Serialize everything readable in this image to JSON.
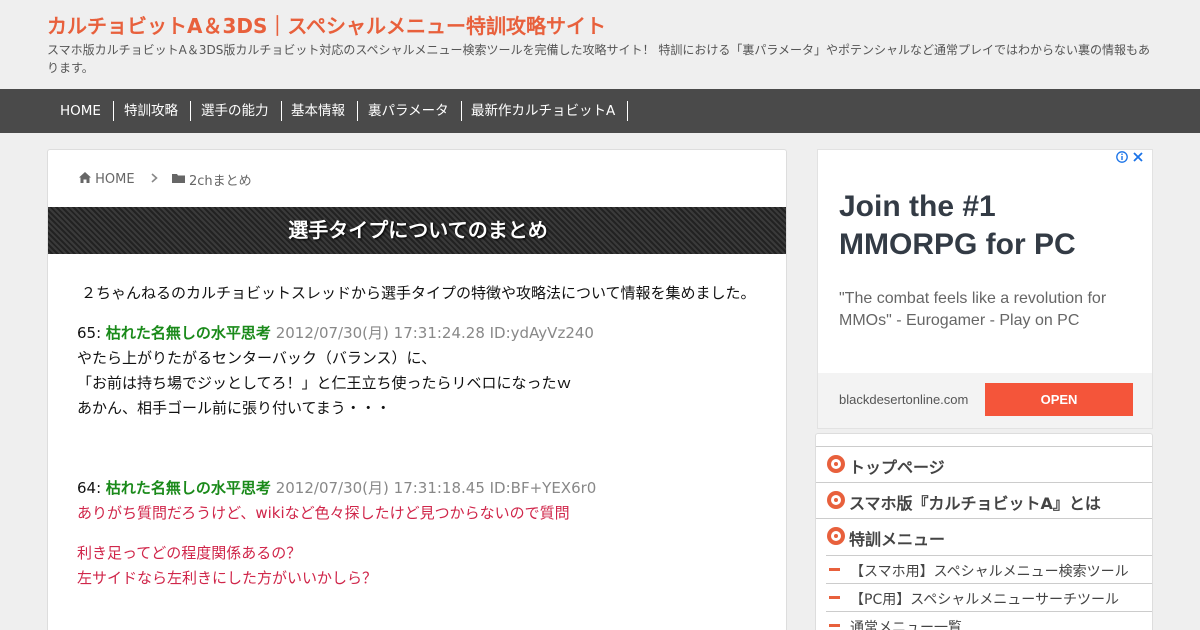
{
  "header": {
    "site_title": "カルチョビットA＆3DS｜スペシャルメニュー特訓攻略サイト",
    "site_description": "スマホ版カルチョビットA＆3DS版カルチョビット対応のスペシャルメニュー検索ツールを完備した攻略サイト！ 特訓における「裏パラメータ」やポテンシャルなど通常プレイではわからない裏の情報もあります。"
  },
  "nav": {
    "items": [
      "HOME",
      "特訓攻略",
      "選手の能力",
      "基本情報",
      "裏パラメータ",
      "最新作カルチョビットA"
    ]
  },
  "breadcrumb": {
    "home_icon": "home-icon",
    "home": "HOME",
    "separator_icon": "chevron-right-icon",
    "category_icon": "folder-icon",
    "category": "2chまとめ"
  },
  "article": {
    "title": "選手タイプについてのまとめ",
    "intro": "２ちゃんねるのカルチョビットスレッドから選手タイプの特徴や攻略法について情報を集めました。",
    "posts": [
      {
        "num": "65:",
        "name": "枯れた名無しの水平思考",
        "meta": "2012/07/30(月) 17:31:24.28 ID:ydAyVz240",
        "lines": [
          "やたら上がりたがるセンターバック（バランス）に、",
          "「お前は持ち場でジッとしてろ！」と仁王立ち使ったらリベロになったｗ",
          "あかん、相手ゴール前に張り付いてまう・・・"
        ]
      },
      {
        "num": "64:",
        "name": "枯れた名無しの水平思考",
        "meta": "2012/07/30(月) 17:31:18.45 ID:BF+YEX6r0",
        "lines": [
          "ありがち質問だろうけど、wikiなど色々探したけど見つからないので質問",
          "利き足ってどの程度関係あるの？",
          "左サイドなら左利きにした方がいいかしら？"
        ]
      }
    ]
  },
  "ad": {
    "icons": [
      "info-icon",
      "close-icon"
    ],
    "headline": "Join the #1 MMORPG for PC",
    "body": "\"The combat feels like a revolution for MMOs\" - Eurogamer - Play on PC",
    "domain": "blackdesertonline.com",
    "cta": "OPEN",
    "colors": {
      "cta": "#f4553a",
      "headline": "#333b45"
    }
  },
  "sidebar": {
    "menu": [
      {
        "label": "トップページ",
        "icon": "soccer-ball-icon"
      },
      {
        "label": "スマホ版『カルチョビットA』とは",
        "icon": "soccer-ball-icon"
      },
      {
        "label": "特訓メニュー",
        "icon": "soccer-ball-icon"
      }
    ],
    "sub_items": [
      "【スマホ用】スペシャルメニュー検索ツール",
      "【PC用】スペシャルメニューサーチツール",
      "通常メニュー一覧"
    ]
  },
  "colors": {
    "accent": "#e8603c",
    "nav_bg": "#4a4a4a",
    "poster_name": "#1a8a1a",
    "question_text": "#d0264a"
  }
}
